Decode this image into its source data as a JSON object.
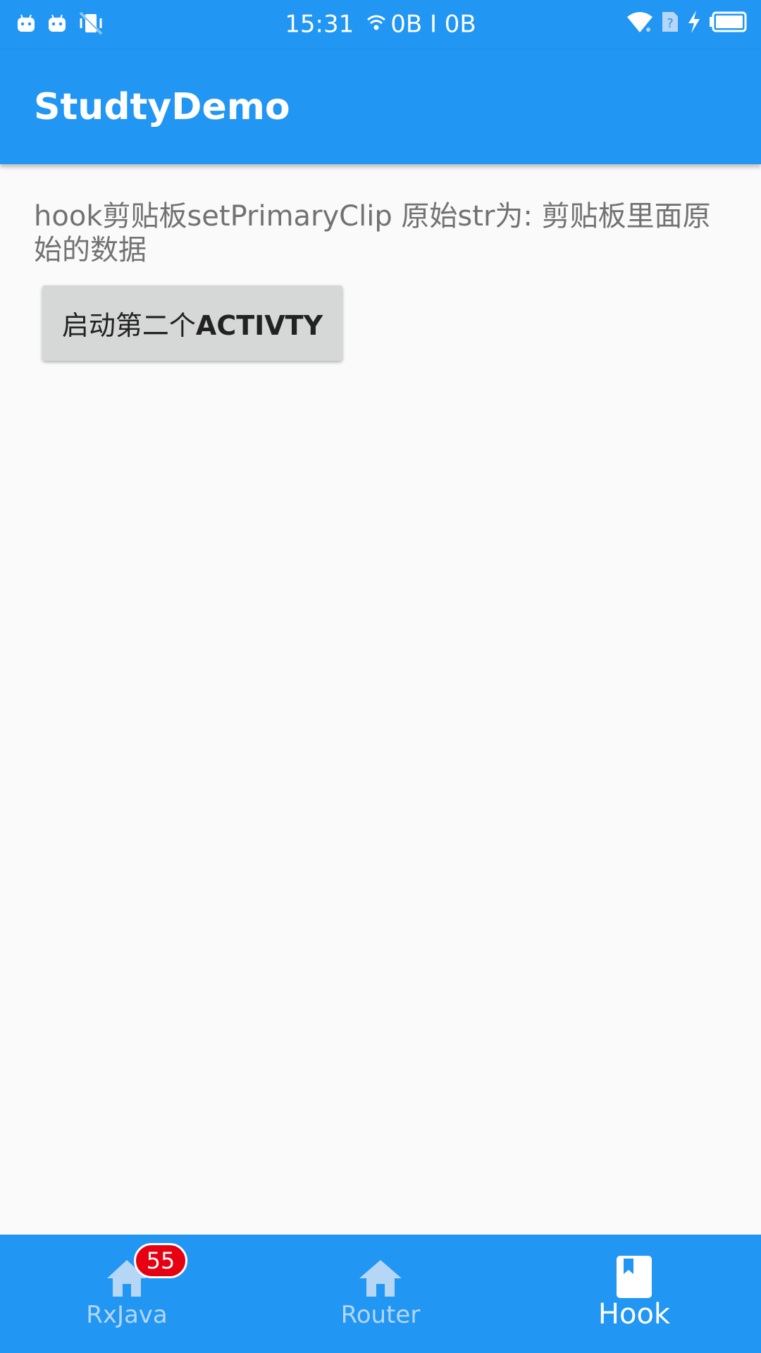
{
  "status_bar": {
    "time": "15:31",
    "network_speed": "0B I 0B",
    "left_icons": [
      "android-icon",
      "android-icon",
      "vibrate-off-icon"
    ],
    "right_icons": [
      "wifi-icon",
      "no-sim-icon",
      "charging-icon",
      "battery-icon"
    ]
  },
  "app_bar": {
    "title": "StudtyDemo"
  },
  "main": {
    "message": "hook剪贴板setPrimaryClip 原始str为: 剪贴板里面原始的数据",
    "button_label_cn": "启动第二个",
    "button_label_en": "ACTIVTY"
  },
  "bottom_nav": {
    "items": [
      {
        "label": "RxJava",
        "icon": "home-icon",
        "badge": "55",
        "active": false
      },
      {
        "label": "Router",
        "icon": "home-icon",
        "active": false
      },
      {
        "label": "Hook",
        "icon": "book-icon",
        "active": true
      }
    ]
  },
  "colors": {
    "primary": "#2196F3",
    "badge": "#E60012",
    "inactive_nav": "#B5D6F5",
    "background": "#FAFAFA"
  }
}
